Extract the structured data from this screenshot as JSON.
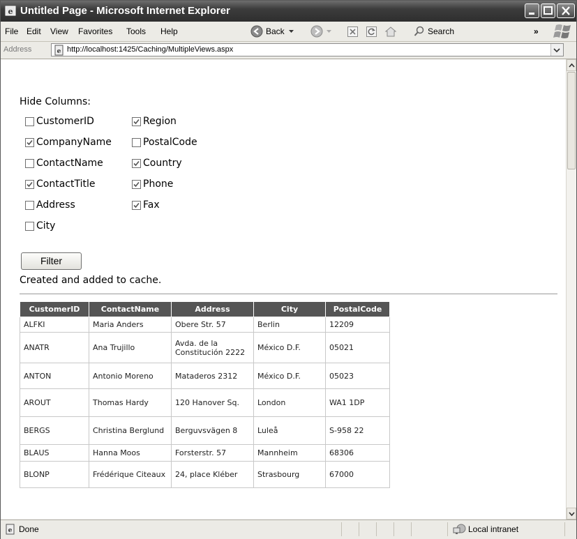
{
  "window": {
    "title": "Untitled Page - Microsoft Internet Explorer"
  },
  "menu": {
    "file": "File",
    "edit": "Edit",
    "view": "View",
    "favorites": "Favorites",
    "tools": "Tools",
    "help": "Help"
  },
  "toolbar": {
    "back": "Back",
    "search": "Search",
    "overflow": "»"
  },
  "address": {
    "label": "Address",
    "url": "http://localhost:1425/Caching/MultipleViews.aspx"
  },
  "page": {
    "hide_label": "Hide Columns:",
    "columns": [
      {
        "label": "CustomerID",
        "checked": false
      },
      {
        "label": "CompanyName",
        "checked": true
      },
      {
        "label": "ContactName",
        "checked": false
      },
      {
        "label": "ContactTitle",
        "checked": true
      },
      {
        "label": "Address",
        "checked": false
      },
      {
        "label": "City",
        "checked": false
      },
      {
        "label": "Region",
        "checked": true
      },
      {
        "label": "PostalCode",
        "checked": false
      },
      {
        "label": "Country",
        "checked": true
      },
      {
        "label": "Phone",
        "checked": true
      },
      {
        "label": "Fax",
        "checked": true
      }
    ],
    "filter_button": "Filter",
    "cache_message": "Created and added to cache."
  },
  "grid": {
    "headers": [
      "CustomerID",
      "ContactName",
      "Address",
      "City",
      "PostalCode"
    ],
    "rows": [
      [
        "ALFKI",
        "Maria Anders",
        "Obere Str. 57",
        "Berlin",
        "12209"
      ],
      [
        "ANATR",
        "Ana Trujillo",
        "Avda. de la Constitución 2222",
        "México D.F.",
        "05021"
      ],
      [
        "ANTON",
        "Antonio Moreno",
        "Mataderos 2312",
        "México D.F.",
        "05023"
      ],
      [
        "AROUT",
        "Thomas Hardy",
        "120 Hanover Sq.",
        "London",
        "WA1 1DP"
      ],
      [
        "BERGS",
        "Christina Berglund",
        "Berguvsvägen 8",
        "Luleå",
        "S-958 22"
      ],
      [
        "BLAUS",
        "Hanna Moos",
        "Forsterstr. 57",
        "Mannheim",
        "68306"
      ],
      [
        "BLONP",
        "Frédérique Citeaux",
        "24, place Kléber",
        "Strasbourg",
        "67000"
      ]
    ]
  },
  "status": {
    "text": "Done",
    "zone": "Local intranet"
  }
}
